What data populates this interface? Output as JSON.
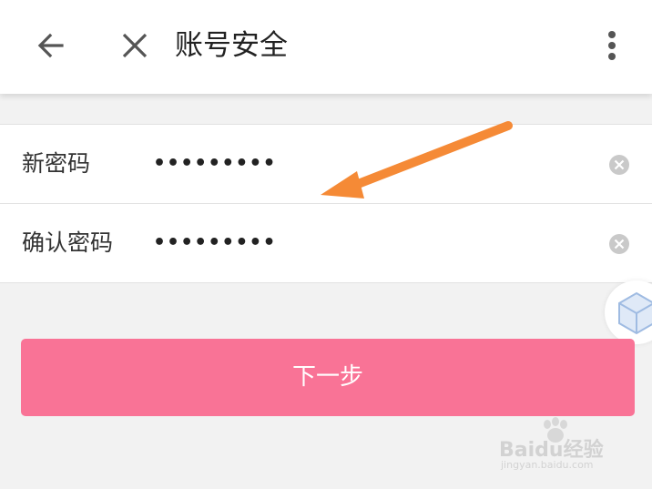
{
  "header": {
    "title": "账号安全",
    "icons": [
      "arrow-back-icon",
      "close-icon",
      "more-vert-icon"
    ]
  },
  "form": {
    "rows": [
      {
        "label": "新密码",
        "value": "•••••••••"
      },
      {
        "label": "确认密码",
        "value": "•••••••••"
      }
    ],
    "clear_icon": "clear-circle-icon"
  },
  "actions": {
    "next_label": "下一步"
  },
  "watermark": {
    "text": "Baidu经验",
    "sub": "jingyan.baidu.com"
  },
  "colors": {
    "primary_button": "#f97396",
    "annotation_arrow": "#f58a36",
    "background": "#f2f2f2",
    "divider": "#e2e2e2"
  }
}
